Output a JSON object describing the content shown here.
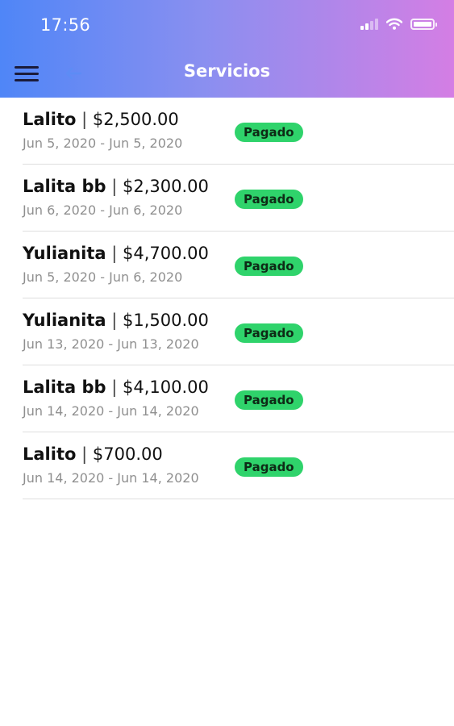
{
  "status_bar": {
    "time": "17:56"
  },
  "nav": {
    "title": "Servicios"
  },
  "colors": {
    "gradient_start": "#4f86f7",
    "gradient_end": "#d47ee4",
    "badge": "#2fd36b"
  },
  "services": [
    {
      "name": "Lalito",
      "separator": "|",
      "amount": "$2,500.00",
      "dates": "Jun 5, 2020 - Jun 5, 2020",
      "status": "Pagado"
    },
    {
      "name": "Lalita bb",
      "separator": "|",
      "amount": "$2,300.00",
      "dates": "Jun 6, 2020 - Jun 6, 2020",
      "status": "Pagado"
    },
    {
      "name": "Yulianita",
      "separator": "|",
      "amount": "$4,700.00",
      "dates": "Jun 5, 2020 - Jun 6, 2020",
      "status": "Pagado"
    },
    {
      "name": "Yulianita",
      "separator": "|",
      "amount": "$1,500.00",
      "dates": "Jun 13, 2020 - Jun 13, 2020",
      "status": "Pagado"
    },
    {
      "name": "Lalita bb",
      "separator": "|",
      "amount": "$4,100.00",
      "dates": "Jun 14, 2020 - Jun 14, 2020",
      "status": "Pagado"
    },
    {
      "name": "Lalito",
      "separator": "|",
      "amount": "$700.00",
      "dates": "Jun 14, 2020 - Jun 14, 2020",
      "status": "Pagado"
    }
  ]
}
